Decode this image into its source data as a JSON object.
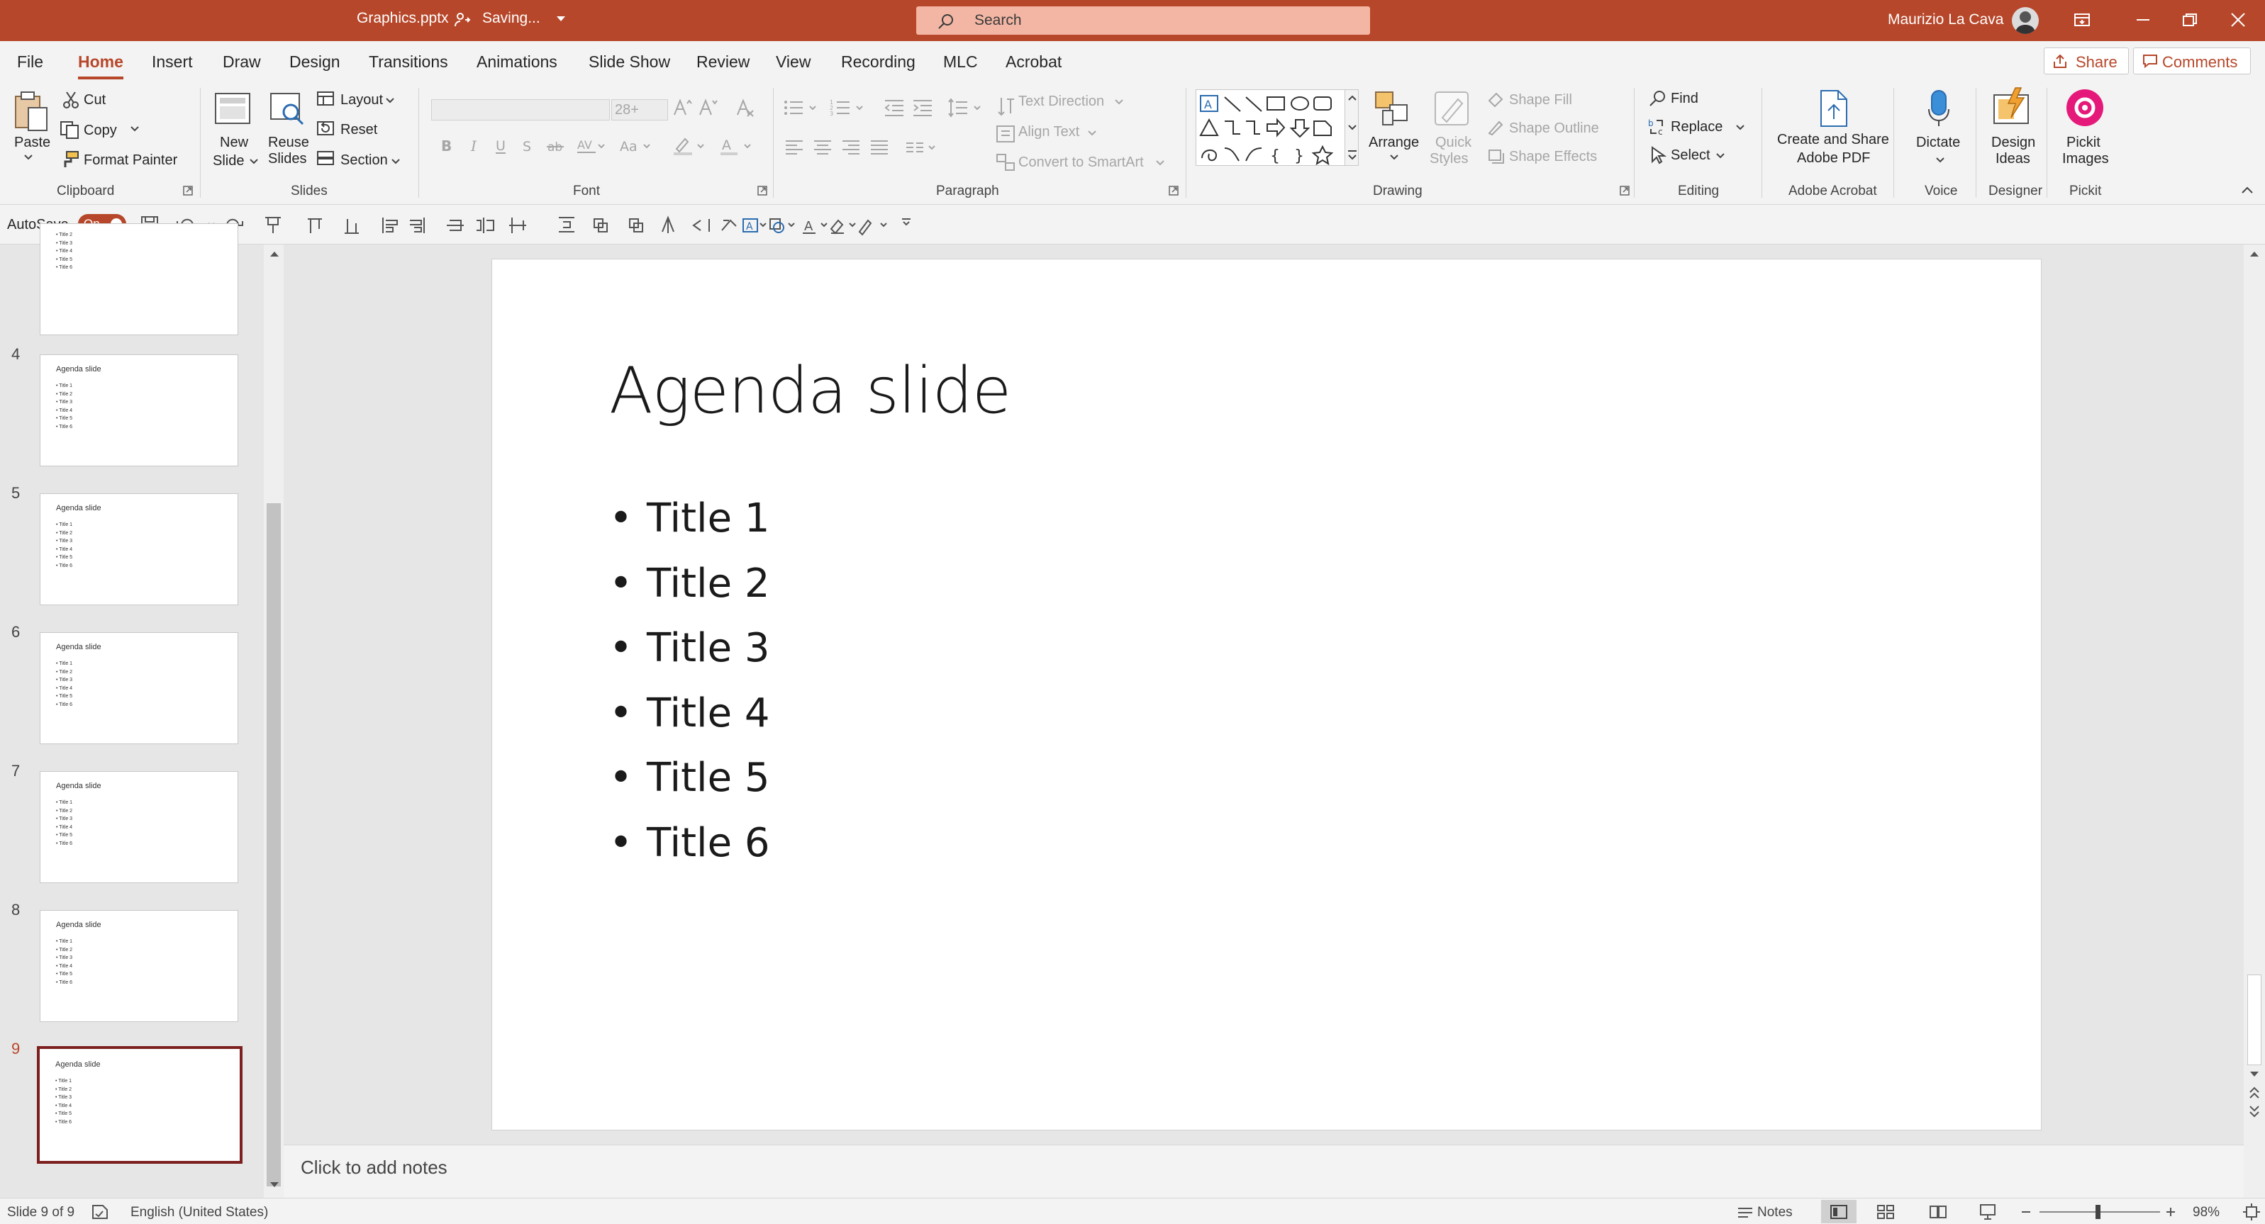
{
  "titlebar": {
    "file_name": "Graphics.pptx",
    "status": "Saving...",
    "search_label": "Search",
    "user_name": "Maurizio La Cava"
  },
  "menu": {
    "tabs": [
      "File",
      "Home",
      "Insert",
      "Draw",
      "Design",
      "Transitions",
      "Animations",
      "Slide Show",
      "Review",
      "View",
      "Recording",
      "MLC",
      "Acrobat"
    ],
    "active_tab": "Home",
    "share_label": "Share",
    "comments_label": "Comments"
  },
  "ribbon": {
    "clipboard": {
      "paste": "Paste",
      "cut": "Cut",
      "copy": "Copy",
      "format_painter": "Format Painter",
      "label": "Clipboard"
    },
    "slides": {
      "new_slide_1": "New",
      "new_slide_2": "Slide",
      "reuse_1": "Reuse",
      "reuse_2": "Slides",
      "layout": "Layout",
      "reset": "Reset",
      "section": "Section",
      "label": "Slides"
    },
    "font": {
      "size": "28+",
      "label": "Font"
    },
    "paragraph": {
      "text_direction": "Text Direction",
      "align_text": "Align Text",
      "convert_smartart": "Convert to SmartArt",
      "label": "Paragraph"
    },
    "drawing": {
      "arrange": "Arrange",
      "quick_1": "Quick",
      "quick_2": "Styles",
      "shape_fill": "Shape Fill",
      "shape_outline": "Shape Outline",
      "shape_effects": "Shape Effects",
      "label": "Drawing"
    },
    "editing": {
      "find": "Find",
      "replace": "Replace",
      "select": "Select",
      "label": "Editing"
    },
    "acrobat": {
      "create_1": "Create and Share",
      "create_2": "Adobe PDF",
      "label": "Adobe Acrobat"
    },
    "voice": {
      "dictate": "Dictate",
      "label": "Voice"
    },
    "designer": {
      "ideas_1": "Design",
      "ideas_2": "Ideas",
      "label": "Designer"
    },
    "pickit": {
      "images_1": "Pickit",
      "images_2": "Images",
      "label": "Pickit"
    }
  },
  "qat": {
    "autosave_label": "AutoSave",
    "autosave_state": "On"
  },
  "thumbnails": {
    "numbers": [
      "4",
      "5",
      "6",
      "7",
      "8",
      "9"
    ],
    "title": "Agenda slide",
    "bullets": "• Title 1\n• Title 2\n• Title 3\n• Title 4\n• Title 5\n• Title 6",
    "partial_bullets": "• Title 2\n• Title 3\n• Title 4\n• Title 5\n• Title 6",
    "selected": "9"
  },
  "slide": {
    "title": "Agenda slide",
    "bullets": [
      "Title 1",
      "Title 2",
      "Title 3",
      "Title 4",
      "Title 5",
      "Title 6"
    ]
  },
  "notes": {
    "placeholder": "Click to add notes"
  },
  "status": {
    "slide_counter": "Slide 9 of 9",
    "language": "English (United States)",
    "notes_label": "Notes",
    "zoom": "98%"
  },
  "colors": {
    "accent": "#b7472a",
    "selected_thumb_border": "#7d1f1f",
    "pickit": "#e5197a",
    "dictate": "#3b8ed8"
  }
}
